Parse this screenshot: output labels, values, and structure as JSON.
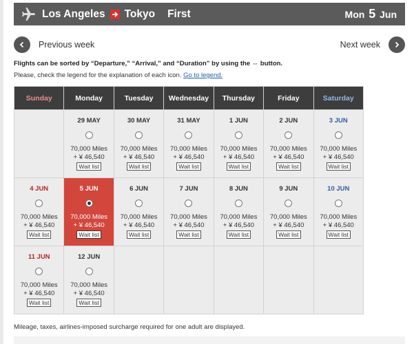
{
  "header": {
    "origin": "Los Angeles",
    "destination": "Tokyo",
    "cabin": "First",
    "weekday": "Mon",
    "day": "5",
    "month": "Jun",
    "plane_icon": "plane-icon",
    "arrow_icon": "arrow-right-icon"
  },
  "nav": {
    "prev_label": "Previous week",
    "next_label": "Next week"
  },
  "info": {
    "sort_note": "Flights can be sorted by “Departure,” “Arrival,” and “Duration” by using the ⇔ button.",
    "legend_note": "Please, check the legend for the explanation of each icon.",
    "legend_link": "Go to legend."
  },
  "calendar": {
    "weekdays": [
      "Sunday",
      "Monday",
      "Tuesday",
      "Wednesday",
      "Thursday",
      "Friday",
      "Saturday"
    ],
    "weeks": [
      [
        {
          "empty": true
        },
        {
          "date": "29 MAY",
          "miles": "70,000 Miles",
          "tax": "+ ¥ 46,540",
          "status": "Wait list"
        },
        {
          "date": "30 MAY",
          "miles": "70,000 Miles",
          "tax": "+ ¥ 46,540",
          "status": "Wait list"
        },
        {
          "date": "31 MAY",
          "miles": "70,000 Miles",
          "tax": "+ ¥ 46,540",
          "status": "Wait list"
        },
        {
          "date": "1 JUN",
          "miles": "70,000 Miles",
          "tax": "+ ¥ 46,540",
          "status": "Wait list"
        },
        {
          "date": "2 JUN",
          "miles": "70,000 Miles",
          "tax": "+ ¥ 46,540",
          "status": "Wait list"
        },
        {
          "date": "3 JUN",
          "miles": "70,000 Miles",
          "tax": "+ ¥ 46,540",
          "status": "Wait list"
        }
      ],
      [
        {
          "date": "4 JUN",
          "miles": "70,000 Miles",
          "tax": "+ ¥ 46,540",
          "status": "Wait list"
        },
        {
          "date": "5 JUN",
          "miles": "70,000 Miles",
          "tax": "+ ¥ 46,540",
          "status": "Wait list",
          "selected": true
        },
        {
          "date": "6 JUN",
          "miles": "70,000 Miles",
          "tax": "+ ¥ 46,540",
          "status": "Wait list"
        },
        {
          "date": "7 JUN",
          "miles": "70,000 Miles",
          "tax": "+ ¥ 46,540",
          "status": "Wait list"
        },
        {
          "date": "8 JUN",
          "miles": "70,000 Miles",
          "tax": "+ ¥ 46,540",
          "status": "Wait list"
        },
        {
          "date": "9 JUN",
          "miles": "70,000 Miles",
          "tax": "+ ¥ 46,540",
          "status": "Wait list"
        },
        {
          "date": "10 JUN",
          "miles": "70,000 Miles",
          "tax": "+ ¥ 46,540",
          "status": "Wait list"
        }
      ],
      [
        {
          "date": "11 JUN",
          "miles": "70,000 Miles",
          "tax": "+ ¥ 46,540",
          "status": "Wait list"
        },
        {
          "date": "12 JUN",
          "miles": "70,000 Miles",
          "tax": "+ ¥ 46,540",
          "status": "Wait list"
        },
        {
          "empty": true
        },
        {
          "empty": true
        },
        {
          "empty": true
        },
        {
          "empty": true
        },
        {
          "empty": true
        }
      ]
    ]
  },
  "footnote": "Mileage, taxes, airlines-imposed surcharge required for one adult are displayed.",
  "colors": {
    "header_bg": "#5b5b5b",
    "accent_red": "#d3463c",
    "sunday": "#b2261f",
    "saturday": "#2e5fa5"
  }
}
